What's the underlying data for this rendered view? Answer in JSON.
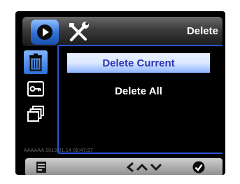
{
  "header": {
    "title": "Delete",
    "tabs": [
      {
        "name": "playback-tab",
        "icon": "play-icon",
        "active": true
      },
      {
        "name": "setup-tab",
        "icon": "tools-icon",
        "active": false
      }
    ]
  },
  "sidebar": {
    "items": [
      {
        "icon": "trash-icon",
        "active": true
      },
      {
        "icon": "key-icon",
        "active": false
      },
      {
        "icon": "layers-icon",
        "active": false
      }
    ]
  },
  "menu": {
    "items": [
      {
        "label": "Delete Current",
        "selected": true
      },
      {
        "label": "Delete All",
        "selected": false
      }
    ]
  },
  "watermark": {
    "text": "AAAAAA 2013.01.14 09:47:27"
  },
  "footer": {
    "icons": [
      "menu-icon",
      "left-arrow-icon",
      "up-arrow-icon",
      "down-arrow-icon",
      "ok-icon"
    ]
  },
  "colors": {
    "accent": "#2f6fd6",
    "selected_text": "#2d32b8",
    "panel_border": "#2a55d8"
  }
}
